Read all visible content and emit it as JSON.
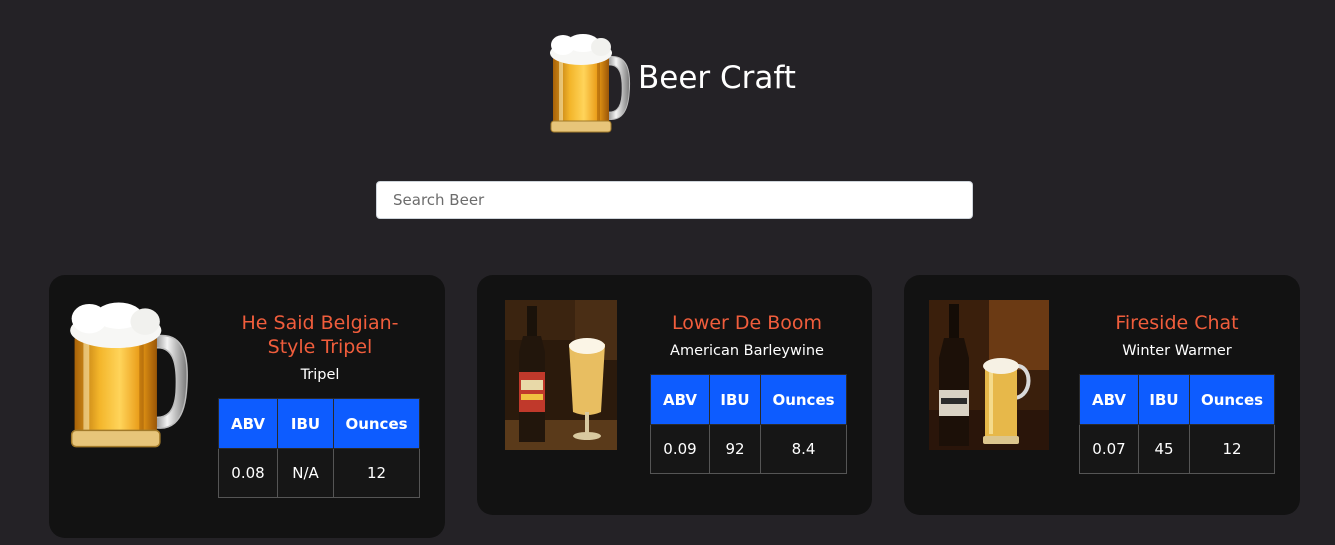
{
  "app": {
    "title": "Beer Craft",
    "logo_icon": "beer-mug-icon"
  },
  "search": {
    "placeholder": "Search Beer",
    "value": ""
  },
  "table_headers": {
    "abv": "ABV",
    "ibu": "IBU",
    "ounces": "Ounces"
  },
  "beers": [
    {
      "name_line1": "He Said Belgian-",
      "name_line2": "Style Tripel",
      "style": "Tripel",
      "abv": "0.08",
      "ibu": "N/A",
      "ounces": "12",
      "image": "beer-mug-icon"
    },
    {
      "name_line1": "Lower De Boom",
      "name_line2": "",
      "style": "American Barleywine",
      "abv": "0.09",
      "ibu": "92",
      "ounces": "8.4",
      "image": "beer-bottle-and-glass-photo"
    },
    {
      "name_line1": "Fireside Chat",
      "name_line2": "",
      "style": "Winter Warmer",
      "abv": "0.07",
      "ibu": "45",
      "ounces": "12",
      "image": "beer-bottle-and-mug-photo"
    }
  ],
  "colors": {
    "background": "#242226",
    "card": "#121212",
    "accent_name": "#f05d3c",
    "table_header": "#0d5cff"
  }
}
